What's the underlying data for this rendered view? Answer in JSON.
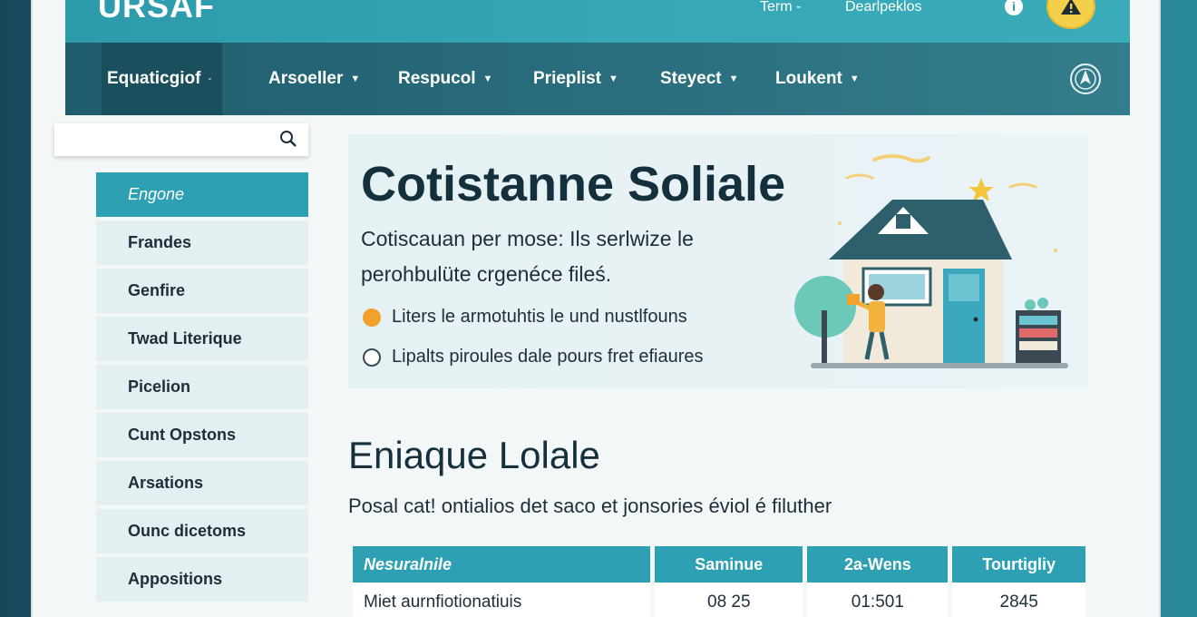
{
  "header": {
    "logo": "URSAF",
    "links": [
      "Term -",
      "Dearlpeklos"
    ]
  },
  "nav": {
    "items": [
      "Equaticgiof",
      "Arsoeller",
      "Respucol",
      "Prieplist",
      "Steyect",
      "Loukent"
    ]
  },
  "search": {
    "placeholder": ""
  },
  "sidebar": {
    "items": [
      "Engone",
      "Frandes",
      "Genfire",
      "Twad Literique",
      "Picelion",
      "Cunt Opstons",
      "Arsations",
      "Ounc dicetoms",
      "Appositions"
    ]
  },
  "hero": {
    "title": "Cotistanne Soliale",
    "description": "Cotiscauan per mose: Ils serlwize le perohbulüte crgenéce filеś.",
    "options": [
      {
        "label": "Liters le armotuhtis le und nustlfouns",
        "selected": true
      },
      {
        "label": "Lipalts piroules dale pours fret efiaures",
        "selected": false
      }
    ]
  },
  "section": {
    "title": "Eniaque Lolale",
    "description": "Posal cat! ontialios det saco et jonsories éviol é filuther"
  },
  "table": {
    "headers": [
      "Nesuralnile",
      "Saminue",
      "2a-Wens",
      "Tourtigliy"
    ],
    "rows": [
      [
        "Miet aurnfiotionatiuis",
        "08 25",
        "01:501",
        "2845"
      ]
    ]
  },
  "colors": {
    "topbar": "#37a8b7",
    "navbar": "#2b6f7f",
    "accent": "#2ea0b3",
    "warning": "#f3cf4a",
    "radio_selected": "#f2a22c"
  }
}
